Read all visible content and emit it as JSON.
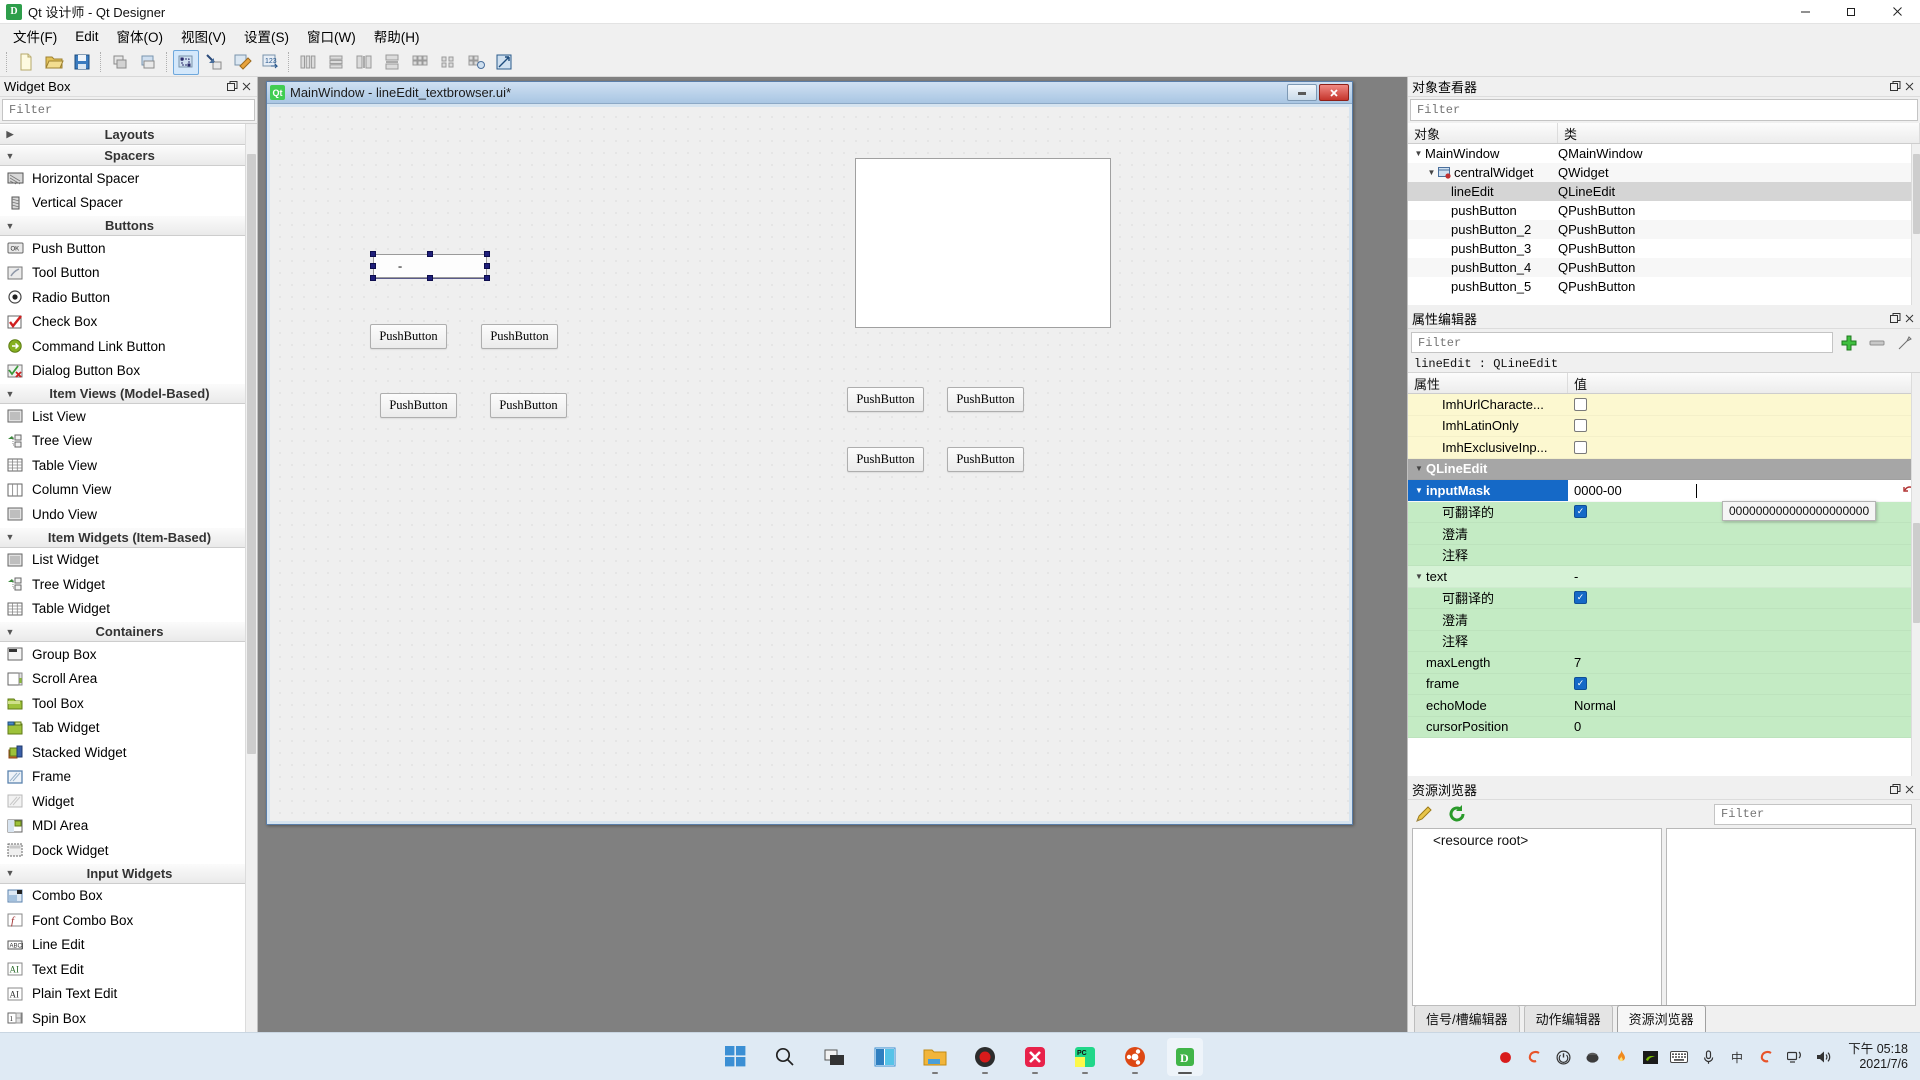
{
  "window": {
    "title": "Qt 设计师 - Qt Designer",
    "app_icon": "qt-designer-icon",
    "minimize": "−",
    "restore": "❐",
    "close": "✕"
  },
  "menubar": {
    "items": [
      {
        "label": "文件(F)",
        "name": "menu-file"
      },
      {
        "label": "Edit",
        "name": "menu-edit"
      },
      {
        "label": "窗体(O)",
        "name": "menu-form"
      },
      {
        "label": "视图(V)",
        "name": "menu-view"
      },
      {
        "label": "设置(S)",
        "name": "menu-settings"
      },
      {
        "label": "窗口(W)",
        "name": "menu-window"
      },
      {
        "label": "帮助(H)",
        "name": "menu-help"
      }
    ]
  },
  "toolbar": {
    "groups": [
      [
        "new-file-icon",
        "open-file-icon",
        "save-file-icon"
      ],
      [
        "undo-icon",
        "redo-icon"
      ],
      [
        "edit-widgets-icon",
        "edit-signals-slots-icon",
        "edit-buddies-icon",
        "edit-tab-order-icon"
      ],
      [
        "layout-horizontally-icon",
        "layout-vertically-icon",
        "layout-horizontal-splitter-icon",
        "layout-vertical-splitter-icon",
        "layout-grid-icon",
        "layout-form-icon",
        "break-layout-icon",
        "adjust-size-icon"
      ]
    ]
  },
  "widget_box": {
    "title": "Widget Box",
    "float_icon": "float-icon",
    "close_icon": "close-icon",
    "filter_placeholder": "Filter",
    "groups": [
      {
        "name": "Layouts",
        "expanded": false,
        "items": []
      },
      {
        "name": "Spacers",
        "expanded": true,
        "items": [
          {
            "label": "Horizontal Spacer",
            "icon": "horizontal-spacer-icon"
          },
          {
            "label": "Vertical Spacer",
            "icon": "vertical-spacer-icon"
          }
        ]
      },
      {
        "name": "Buttons",
        "expanded": true,
        "items": [
          {
            "label": "Push Button",
            "icon": "push-button-icon"
          },
          {
            "label": "Tool Button",
            "icon": "tool-button-icon"
          },
          {
            "label": "Radio Button",
            "icon": "radio-button-icon"
          },
          {
            "label": "Check Box",
            "icon": "check-box-icon"
          },
          {
            "label": "Command Link Button",
            "icon": "command-link-button-icon"
          },
          {
            "label": "Dialog Button Box",
            "icon": "dialog-button-box-icon"
          }
        ]
      },
      {
        "name": "Item Views (Model-Based)",
        "expanded": true,
        "items": [
          {
            "label": "List View",
            "icon": "list-view-icon"
          },
          {
            "label": "Tree View",
            "icon": "tree-view-icon"
          },
          {
            "label": "Table View",
            "icon": "table-view-icon"
          },
          {
            "label": "Column View",
            "icon": "column-view-icon"
          },
          {
            "label": "Undo View",
            "icon": "undo-view-icon"
          }
        ]
      },
      {
        "name": "Item Widgets (Item-Based)",
        "expanded": true,
        "items": [
          {
            "label": "List Widget",
            "icon": "list-widget-icon"
          },
          {
            "label": "Tree Widget",
            "icon": "tree-widget-icon"
          },
          {
            "label": "Table Widget",
            "icon": "table-widget-icon"
          }
        ]
      },
      {
        "name": "Containers",
        "expanded": true,
        "items": [
          {
            "label": "Group Box",
            "icon": "group-box-icon"
          },
          {
            "label": "Scroll Area",
            "icon": "scroll-area-icon"
          },
          {
            "label": "Tool Box",
            "icon": "tool-box-icon"
          },
          {
            "label": "Tab Widget",
            "icon": "tab-widget-icon"
          },
          {
            "label": "Stacked Widget",
            "icon": "stacked-widget-icon"
          },
          {
            "label": "Frame",
            "icon": "frame-icon"
          },
          {
            "label": "Widget",
            "icon": "widget-icon"
          },
          {
            "label": "MDI Area",
            "icon": "mdi-area-icon"
          },
          {
            "label": "Dock Widget",
            "icon": "dock-widget-icon"
          }
        ]
      },
      {
        "name": "Input Widgets",
        "expanded": true,
        "items": [
          {
            "label": "Combo Box",
            "icon": "combo-box-icon"
          },
          {
            "label": "Font Combo Box",
            "icon": "font-combo-box-icon"
          },
          {
            "label": "Line Edit",
            "icon": "line-edit-icon"
          },
          {
            "label": "Text Edit",
            "icon": "text-edit-icon"
          },
          {
            "label": "Plain Text Edit",
            "icon": "plain-text-edit-icon"
          },
          {
            "label": "Spin Box",
            "icon": "spin-box-icon"
          }
        ]
      }
    ]
  },
  "form_window": {
    "title": "MainWindow - lineEdit_textbrowser.ui*",
    "icon": "qt-form-icon",
    "minimize_label": "−",
    "close_label": "✕",
    "widgets": {
      "line_edit": {
        "text": "-",
        "selected": true
      },
      "push_buttons": [
        {
          "label": "PushButton"
        },
        {
          "label": "PushButton"
        },
        {
          "label": "PushButton"
        },
        {
          "label": "PushButton"
        },
        {
          "label": "PushButton"
        },
        {
          "label": "PushButton"
        },
        {
          "label": "PushButton"
        },
        {
          "label": "PushButton"
        }
      ],
      "text_browser": {
        "content": ""
      }
    }
  },
  "object_inspector": {
    "title": "对象查看器",
    "float_icon": "float-icon",
    "close_icon": "close-icon",
    "filter_placeholder": "Filter",
    "columns": [
      "对象",
      "类"
    ],
    "rows": [
      {
        "object": "MainWindow",
        "class": "QMainWindow",
        "depth": 0,
        "twisty": "▼",
        "selected": false,
        "icon": ""
      },
      {
        "object": "centralWidget",
        "class": "QWidget",
        "depth": 1,
        "twisty": "▼",
        "selected": false,
        "icon": "central-widget-icon"
      },
      {
        "object": "lineEdit",
        "class": "QLineEdit",
        "depth": 2,
        "twisty": "",
        "selected": true,
        "icon": ""
      },
      {
        "object": "pushButton",
        "class": "QPushButton",
        "depth": 2,
        "twisty": "",
        "selected": false,
        "icon": ""
      },
      {
        "object": "pushButton_2",
        "class": "QPushButton",
        "depth": 2,
        "twisty": "",
        "selected": false,
        "icon": ""
      },
      {
        "object": "pushButton_3",
        "class": "QPushButton",
        "depth": 2,
        "twisty": "",
        "selected": false,
        "icon": ""
      },
      {
        "object": "pushButton_4",
        "class": "QPushButton",
        "depth": 2,
        "twisty": "",
        "selected": false,
        "icon": ""
      },
      {
        "object": "pushButton_5",
        "class": "QPushButton",
        "depth": 2,
        "twisty": "",
        "selected": false,
        "icon": ""
      }
    ]
  },
  "property_editor": {
    "title": "属性编辑器",
    "float_icon": "float-icon",
    "close_icon": "close-icon",
    "filter_placeholder": "Filter",
    "add_icon": "add-icon",
    "remove_icon": "remove-icon",
    "configure_icon": "configure-icon",
    "object_line": "lineEdit : QLineEdit",
    "columns": [
      "属性",
      "值"
    ],
    "tooltip": "000000000000000000000",
    "rows": [
      {
        "key": "ImhUrlCharacte...",
        "value": "",
        "type": "checkbox",
        "checked": false,
        "style": "yellow",
        "indent": 1
      },
      {
        "key": "ImhLatinOnly",
        "value": "",
        "type": "checkbox",
        "checked": false,
        "style": "yellow",
        "indent": 1
      },
      {
        "key": "ImhExclusiveInp...",
        "value": "",
        "type": "checkbox",
        "checked": false,
        "style": "yellow",
        "indent": 1
      },
      {
        "key": "QLineEdit",
        "value": "",
        "type": "group",
        "style": "grouphdr",
        "twisty": "▼",
        "indent": 0
      },
      {
        "key": "inputMask",
        "value": "0000-00",
        "type": "text-edit",
        "style": "selected",
        "twisty": "▼",
        "indent": 0
      },
      {
        "key": "可翻译的",
        "value": "",
        "type": "checkbox",
        "checked": true,
        "style": "green",
        "indent": 1
      },
      {
        "key": "澄清",
        "value": "",
        "type": "blank",
        "style": "green",
        "indent": 1
      },
      {
        "key": "注释",
        "value": "",
        "type": "blank",
        "style": "green",
        "indent": 1
      },
      {
        "key": "text",
        "value": "-",
        "type": "value",
        "style": "green2",
        "twisty": "▼",
        "indent": 0
      },
      {
        "key": "可翻译的",
        "value": "",
        "type": "checkbox",
        "checked": true,
        "style": "green",
        "indent": 1
      },
      {
        "key": "澄清",
        "value": "",
        "type": "blank",
        "style": "green",
        "indent": 1
      },
      {
        "key": "注释",
        "value": "",
        "type": "blank",
        "style": "green",
        "indent": 1
      },
      {
        "key": "maxLength",
        "value": "7",
        "type": "value",
        "style": "green",
        "indent": 0
      },
      {
        "key": "frame",
        "value": "",
        "type": "checkbox",
        "checked": true,
        "style": "green",
        "indent": 0
      },
      {
        "key": "echoMode",
        "value": "Normal",
        "type": "value",
        "style": "green",
        "indent": 0
      },
      {
        "key": "cursorPosition",
        "value": "0",
        "type": "value",
        "style": "green",
        "indent": 0
      }
    ]
  },
  "resource_browser": {
    "title": "资源浏览器",
    "float_icon": "float-icon",
    "close_icon": "close-icon",
    "edit_icon": "edit-pencil-icon",
    "reload_icon": "reload-icon",
    "filter_placeholder": "Filter",
    "root_label": "<resource root>",
    "tabs": [
      {
        "label": "信号/槽编辑器",
        "active": false
      },
      {
        "label": "动作编辑器",
        "active": false
      },
      {
        "label": "资源浏览器",
        "active": true
      }
    ]
  },
  "taskbar": {
    "items": [
      {
        "icon": "windows-start-icon",
        "running": false,
        "active": false
      },
      {
        "icon": "search-icon",
        "running": false,
        "active": false
      },
      {
        "icon": "task-view-icon",
        "running": false,
        "active": false
      },
      {
        "icon": "widgets-icon",
        "running": false,
        "active": false
      },
      {
        "icon": "file-explorer-icon",
        "running": true,
        "active": false
      },
      {
        "icon": "recorder-icon",
        "running": true,
        "active": false
      },
      {
        "icon": "xmind-icon",
        "running": true,
        "active": false
      },
      {
        "icon": "pycharm-icon",
        "running": true,
        "active": false
      },
      {
        "icon": "ubuntu-icon",
        "running": true,
        "active": false
      },
      {
        "icon": "qt-designer-icon",
        "running": true,
        "active": true
      }
    ],
    "tray": [
      "record-dot-icon",
      "sogou-icon",
      "power-icon",
      "mouse-icon",
      "flame-icon",
      "nvidia-icon",
      "keyboard-icon",
      "microphone-icon",
      "ime-chinese-icon",
      "sogou-pinyin-icon",
      "network-icon",
      "volume-icon"
    ],
    "clock": {
      "time": "下午 05:18",
      "date": "2021/7/6"
    }
  }
}
